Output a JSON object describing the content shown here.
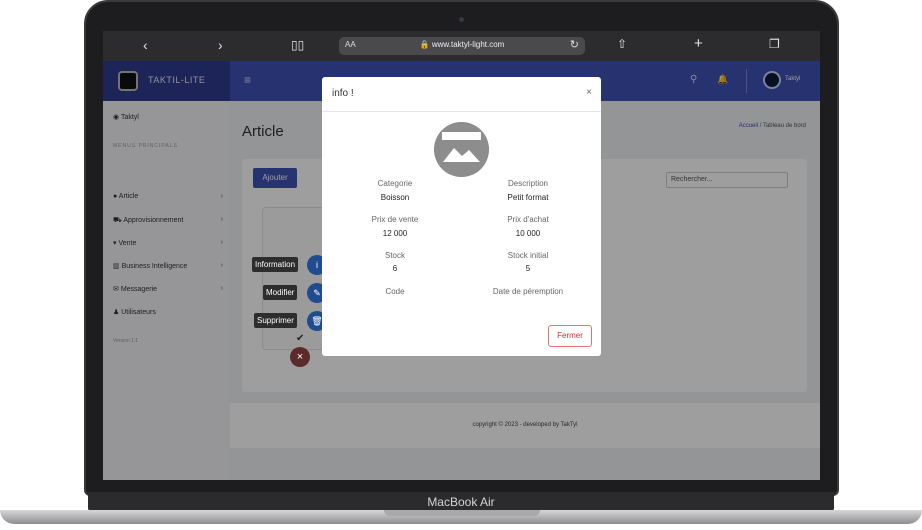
{
  "device": {
    "label": "MacBook Air"
  },
  "browser": {
    "text_size": "AA",
    "url": "www.taktyl-light.com"
  },
  "brand": {
    "name": "TAKTIL-LITE"
  },
  "sidebar": {
    "user": "Taktyl",
    "section": "MENUS PRINCIPALS",
    "items": [
      {
        "label": "Article"
      },
      {
        "label": "Approvisionnement"
      },
      {
        "label": "Vente"
      },
      {
        "label": "Business Intelligence"
      },
      {
        "label": "Messagerie"
      },
      {
        "label": "Utilisateurs"
      }
    ],
    "version": "Version 1.1"
  },
  "topbar": {
    "user_name": "Taktyl"
  },
  "page": {
    "title": "Article",
    "breadcrumb_home": "Accueil",
    "breadcrumb_sep": "/",
    "breadcrumb_current": "Tableau de bord",
    "add_label": "Ajouter",
    "search_placeholder": "Rechercher...",
    "footer": "copyright © 2023 - developed by TakTyl"
  },
  "tooltips": {
    "info": "Information",
    "edit": "Modifier",
    "delete": "Supprimer"
  },
  "modal": {
    "title": "info !",
    "close": "×",
    "fields": {
      "categorie_label": "Categorie",
      "categorie_value": "Boisson",
      "description_label": "Description",
      "description_value": "Petit format",
      "prix_vente_label": "Prix de vente",
      "prix_vente_value": "12 000",
      "prix_achat_label": "Prix d'achat",
      "prix_achat_value": "10 000",
      "stock_label": "Stock",
      "stock_value": "6",
      "stock_initial_label": "Stock initial",
      "stock_initial_value": "5",
      "code_label": "Code",
      "peremption_label": "Date de péremption"
    },
    "button": "Fermer"
  },
  "colors": {
    "primary": "#3f51b5",
    "sidebar_brand": "#2f3d8f",
    "danger": "#d32f2f"
  }
}
